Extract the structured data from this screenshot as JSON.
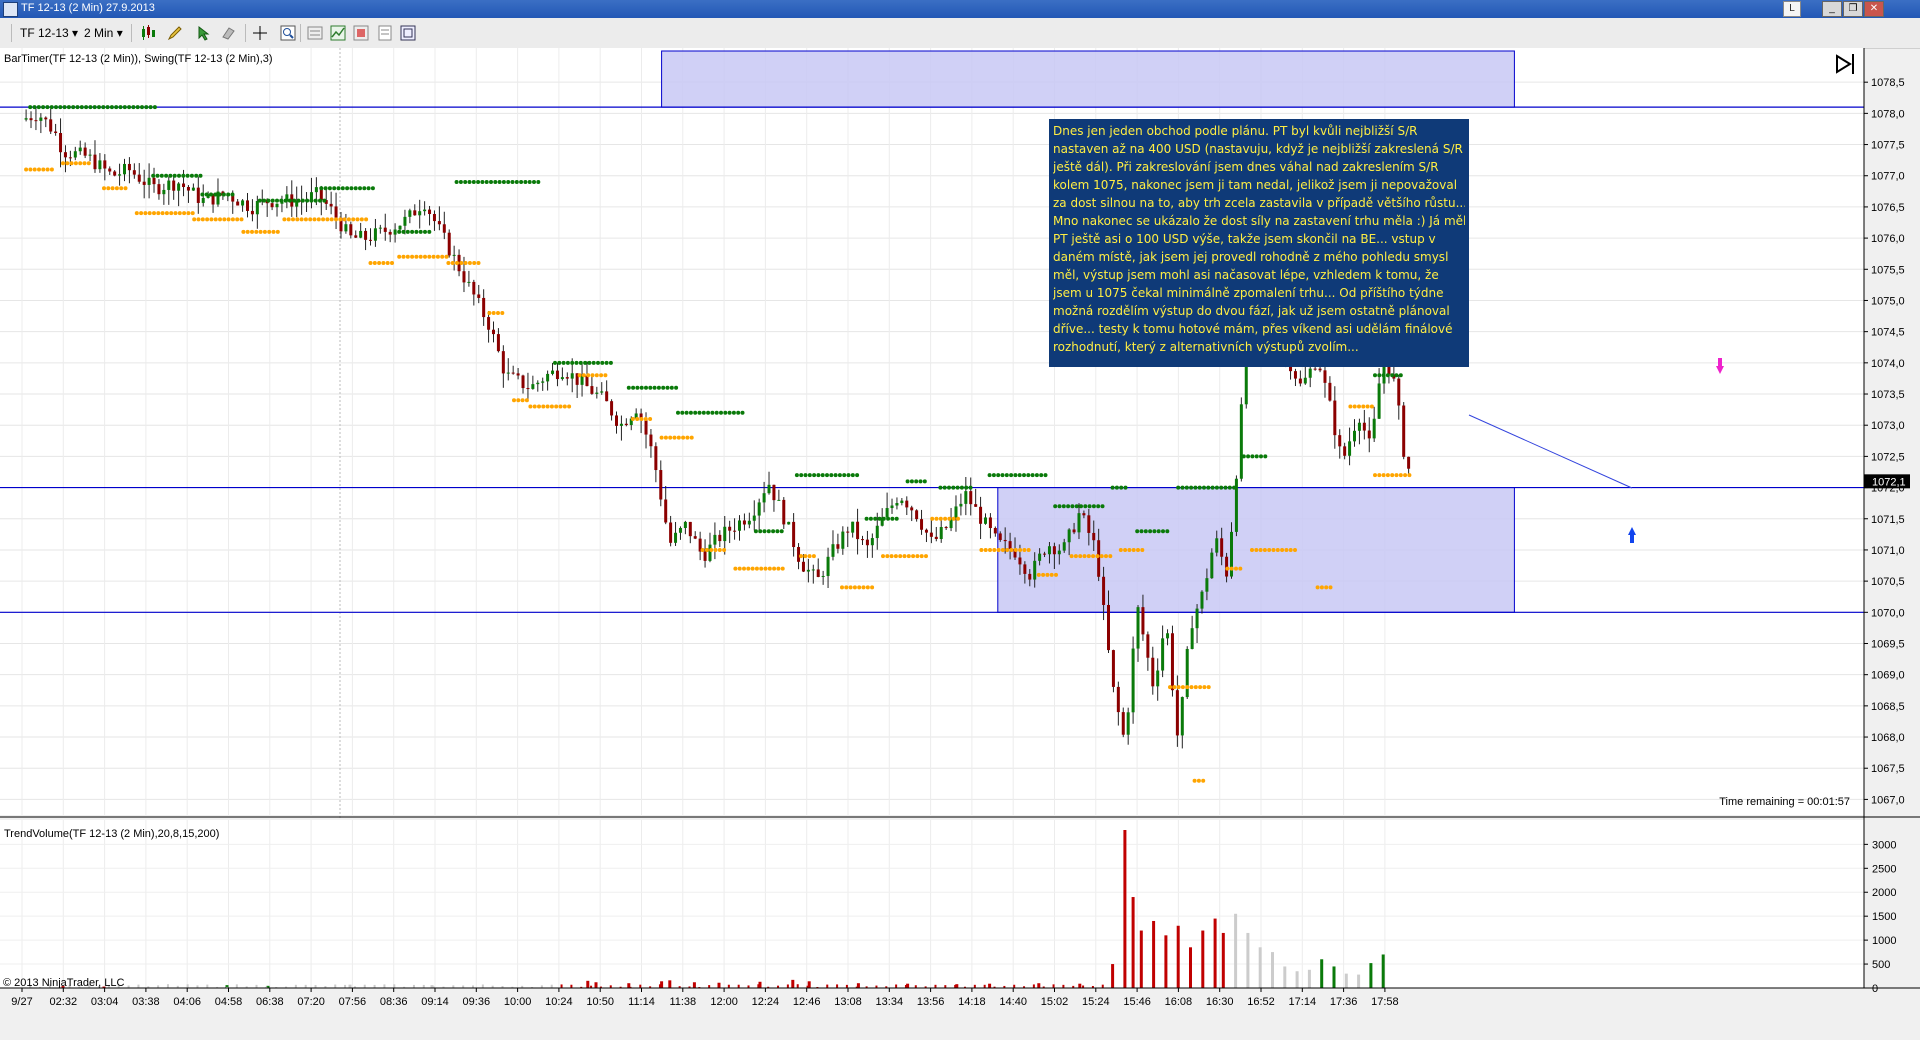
{
  "window": {
    "title": "TF 12-13 (2 Min)   27.9.2013",
    "badge": "L",
    "minimize_glyph": "_",
    "restore_glyph": "❐",
    "close_glyph": "✕"
  },
  "toolbar": {
    "instrument": "TF 12-13",
    "interval": "2 Min",
    "dropdown_glyph": "▾"
  },
  "indicators": {
    "main_label": "BarTimer(TF 12-13 (2 Min)), Swing(TF 12-13 (2 Min),3)",
    "volume_label": "TrendVolume(TF 12-13 (2 Min),20,8,15,200)",
    "time_remaining": "Time remaining = 00:01:57",
    "copyright": "© 2013 NinjaTrader, LLC"
  },
  "annotation": {
    "lines": [
      "Dnes jen jeden obchod podle plánu. PT byl kvůli nejbližší S/R",
      "nastaven až na 400 USD (nastavuju, když je nejbližší zakreslená S/R",
      "ještě dál). Při zakreslování jsem dnes váhal nad zakreslením S/R",
      "kolem 1075, nakonec jsem ji tam nedal, jelikož jsem ji nepovažoval",
      "za dost silnou na to, aby trh zcela zastavila v případě většího růstu...",
      "Mno nakonec se ukázalo že dost síly na zastavení trhu měla :) Já měl",
      "PT ještě asi o 100 USD výše, takže jsem skončil na BE... vstup v",
      "daném místě, jak jsem jej provedl rohodně z mého pohledu smysl",
      "měl, výstup  jsem mohl asi načasovat lépe, vzhledem k tomu, že",
      "jsem u 1075 čekal minimálně zpomalení trhu... Od příštího týdne",
      "možná rozdělím výstup do dvou fází, jak už jsem ostatně plánoval",
      "dříve... testy k tomu hotové mám, přes víkend asi udělám finálové",
      "rozhodnutí, který z alternativních výstupů zvolím..."
    ]
  },
  "chart_data": [
    {
      "type": "candlestick",
      "title": "TF 12-13 (2 Min)",
      "price_axis_ticks": [
        "1078,5",
        "1078,0",
        "1077,5",
        "1077,0",
        "1076,5",
        "1076,0",
        "1075,5",
        "1075,0",
        "1074,5",
        "1074,0",
        "1073,5",
        "1073,0",
        "1072,5",
        "1072,0",
        "1071,5",
        "1071,0",
        "1070,5",
        "1070,0",
        "1069,5",
        "1069,0",
        "1068,5",
        "1068,0",
        "1067,5",
        "1067,0"
      ],
      "ylim": [
        1066.75,
        1079.0
      ],
      "time_axis_ticks": [
        "9/27",
        "02:32",
        "03:04",
        "03:38",
        "04:06",
        "04:58",
        "06:38",
        "07:20",
        "07:56",
        "08:36",
        "09:14",
        "09:36",
        "10:00",
        "10:24",
        "10:50",
        "11:14",
        "11:38",
        "12:00",
        "12:24",
        "12:46",
        "13:08",
        "13:34",
        "13:56",
        "14:18",
        "14:40",
        "15:02",
        "15:24",
        "15:46",
        "16:08",
        "16:30",
        "16:52",
        "17:14",
        "17:36",
        "17:58"
      ],
      "last_price": 1072.1,
      "last_price_label": "1072,1",
      "close_path": [
        [
          0,
          1077.9
        ],
        [
          0.4,
          1078.0
        ],
        [
          0.8,
          1077.7
        ],
        [
          1.0,
          1077.4
        ],
        [
          1.6,
          1077.3
        ],
        [
          2.2,
          1077.0
        ],
        [
          2.6,
          1077.1
        ],
        [
          3.2,
          1076.8
        ],
        [
          3.8,
          1076.9
        ],
        [
          4.4,
          1076.6
        ],
        [
          5.0,
          1076.7
        ],
        [
          5.6,
          1076.5
        ],
        [
          6.0,
          1076.6
        ],
        [
          6.8,
          1076.6
        ],
        [
          7.2,
          1076.7
        ],
        [
          7.6,
          1076.4
        ],
        [
          8.0,
          1076.0
        ],
        [
          8.4,
          1076.0
        ],
        [
          8.8,
          1076.1
        ],
        [
          9.4,
          1076.3
        ],
        [
          9.8,
          1076.6
        ],
        [
          10.2,
          1076.1
        ],
        [
          10.6,
          1075.6
        ],
        [
          11.0,
          1075.1
        ],
        [
          11.4,
          1074.6
        ],
        [
          11.8,
          1073.8
        ],
        [
          12.4,
          1073.6
        ],
        [
          12.8,
          1073.8
        ],
        [
          13.2,
          1073.9
        ],
        [
          13.6,
          1073.7
        ],
        [
          14.2,
          1073.4
        ],
        [
          14.6,
          1073.0
        ],
        [
          15.0,
          1073.3
        ],
        [
          15.4,
          1072.5
        ],
        [
          15.8,
          1071.1
        ],
        [
          16.2,
          1071.4
        ],
        [
          16.6,
          1070.9
        ],
        [
          17.0,
          1071.2
        ],
        [
          17.4,
          1071.4
        ],
        [
          17.8,
          1071.6
        ],
        [
          18.2,
          1072.1
        ],
        [
          18.6,
          1071.5
        ],
        [
          19.0,
          1070.8
        ],
        [
          19.4,
          1070.5
        ],
        [
          19.8,
          1071.0
        ],
        [
          20.2,
          1071.4
        ],
        [
          20.6,
          1071.0
        ],
        [
          21.0,
          1071.5
        ],
        [
          21.4,
          1071.9
        ],
        [
          21.8,
          1071.6
        ],
        [
          22.2,
          1071.1
        ],
        [
          22.6,
          1071.4
        ],
        [
          23.0,
          1071.9
        ],
        [
          23.4,
          1071.5
        ],
        [
          23.8,
          1071.1
        ],
        [
          24.2,
          1071.0
        ],
        [
          24.6,
          1070.6
        ],
        [
          25.0,
          1071.1
        ],
        [
          25.4,
          1071.0
        ],
        [
          25.8,
          1071.6
        ],
        [
          26.2,
          1071.0
        ],
        [
          26.6,
          1068.8
        ],
        [
          26.9,
          1067.9
        ],
        [
          27.2,
          1070.1
        ],
        [
          27.6,
          1068.8
        ],
        [
          27.9,
          1069.9
        ],
        [
          28.2,
          1067.9
        ],
        [
          28.5,
          1069.8
        ],
        [
          28.8,
          1070.3
        ],
        [
          29.1,
          1071.2
        ],
        [
          29.4,
          1070.6
        ],
        [
          29.6,
          1072.1
        ],
        [
          29.8,
          1073.7
        ],
        [
          30.0,
          1075.6
        ],
        [
          30.4,
          1074.6
        ],
        [
          30.8,
          1074.2
        ],
        [
          31.2,
          1073.6
        ],
        [
          31.6,
          1074.1
        ],
        [
          31.9,
          1073.3
        ],
        [
          32.2,
          1072.4
        ],
        [
          32.6,
          1073.2
        ],
        [
          32.9,
          1072.6
        ],
        [
          33.2,
          1074.2
        ],
        [
          33.5,
          1073.6
        ],
        [
          33.7,
          1072.6
        ],
        [
          33.9,
          1072.1
        ]
      ],
      "swing_high_levels": [
        {
          "x0": 0.2,
          "x1": 3.3,
          "y": 1078.1
        },
        {
          "x0": 3.2,
          "x1": 4.4,
          "y": 1077.0
        },
        {
          "x0": 4.4,
          "x1": 5.2,
          "y": 1076.7
        },
        {
          "x0": 5.8,
          "x1": 7.4,
          "y": 1076.6
        },
        {
          "x0": 7.3,
          "x1": 8.6,
          "y": 1076.8
        },
        {
          "x0": 9.2,
          "x1": 10.0,
          "y": 1076.1
        },
        {
          "x0": 10.6,
          "x1": 12.6,
          "y": 1076.9
        },
        {
          "x0": 13.0,
          "x1": 14.4,
          "y": 1074.0
        },
        {
          "x0": 14.8,
          "x1": 16.0,
          "y": 1073.6
        },
        {
          "x0": 16.0,
          "x1": 17.6,
          "y": 1073.2
        },
        {
          "x0": 17.9,
          "x1": 18.6,
          "y": 1071.3
        },
        {
          "x0": 18.9,
          "x1": 20.4,
          "y": 1072.2
        },
        {
          "x0": 20.6,
          "x1": 21.4,
          "y": 1071.5
        },
        {
          "x0": 21.6,
          "x1": 22.1,
          "y": 1072.1
        },
        {
          "x0": 22.4,
          "x1": 23.2,
          "y": 1072.0
        },
        {
          "x0": 23.6,
          "x1": 25.0,
          "y": 1072.2
        },
        {
          "x0": 25.2,
          "x1": 26.4,
          "y": 1071.7
        },
        {
          "x0": 26.6,
          "x1": 27.0,
          "y": 1072.0
        },
        {
          "x0": 27.2,
          "x1": 28.0,
          "y": 1071.3
        },
        {
          "x0": 28.2,
          "x1": 29.6,
          "y": 1072.0
        },
        {
          "x0": 29.8,
          "x1": 30.4,
          "y": 1072.5
        },
        {
          "x0": 30.8,
          "x1": 32.0,
          "y": 1075.8
        },
        {
          "x0": 32.4,
          "x1": 32.9,
          "y": 1074.7
        },
        {
          "x0": 33.0,
          "x1": 33.7,
          "y": 1073.8
        },
        {
          "x0": 33.9,
          "x1": 34.2,
          "y": 1075.2
        }
      ],
      "swing_low_levels": [
        {
          "x0": 0.1,
          "x1": 0.8,
          "y": 1077.1
        },
        {
          "x0": 1.0,
          "x1": 1.7,
          "y": 1077.2
        },
        {
          "x0": 2.0,
          "x1": 2.6,
          "y": 1076.8
        },
        {
          "x0": 2.8,
          "x1": 4.2,
          "y": 1076.4
        },
        {
          "x0": 4.2,
          "x1": 5.4,
          "y": 1076.3
        },
        {
          "x0": 5.4,
          "x1": 6.3,
          "y": 1076.1
        },
        {
          "x0": 6.4,
          "x1": 8.4,
          "y": 1076.3
        },
        {
          "x0": 8.5,
          "x1": 9.1,
          "y": 1075.6
        },
        {
          "x0": 9.2,
          "x1": 10.4,
          "y": 1075.7
        },
        {
          "x0": 10.4,
          "x1": 11.2,
          "y": 1075.6
        },
        {
          "x0": 11.4,
          "x1": 11.8,
          "y": 1074.8
        },
        {
          "x0": 12.0,
          "x1": 12.4,
          "y": 1073.4
        },
        {
          "x0": 12.4,
          "x1": 13.4,
          "y": 1073.3
        },
        {
          "x0": 13.6,
          "x1": 14.3,
          "y": 1073.8
        },
        {
          "x0": 14.9,
          "x1": 15.4,
          "y": 1073.1
        },
        {
          "x0": 15.6,
          "x1": 16.4,
          "y": 1072.8
        },
        {
          "x0": 16.6,
          "x1": 17.2,
          "y": 1071.0
        },
        {
          "x0": 17.4,
          "x1": 18.6,
          "y": 1070.7
        },
        {
          "x0": 19.0,
          "x1": 19.4,
          "y": 1070.9
        },
        {
          "x0": 20.0,
          "x1": 20.8,
          "y": 1070.4
        },
        {
          "x0": 21.0,
          "x1": 22.1,
          "y": 1070.9
        },
        {
          "x0": 22.2,
          "x1": 22.9,
          "y": 1071.5
        },
        {
          "x0": 23.4,
          "x1": 24.6,
          "y": 1071.0
        },
        {
          "x0": 24.8,
          "x1": 25.3,
          "y": 1070.6
        },
        {
          "x0": 25.6,
          "x1": 26.6,
          "y": 1070.9
        },
        {
          "x0": 26.8,
          "x1": 27.4,
          "y": 1071.0
        },
        {
          "x0": 28.0,
          "x1": 29.0,
          "y": 1068.8
        },
        {
          "x0": 29.4,
          "x1": 29.8,
          "y": 1070.7
        },
        {
          "x0": 30.0,
          "x1": 31.1,
          "y": 1071.0
        },
        {
          "x0": 31.6,
          "x1": 32.0,
          "y": 1070.4
        },
        {
          "x0": 32.4,
          "x1": 33.0,
          "y": 1073.3
        },
        {
          "x0": 33.0,
          "x1": 33.9,
          "y": 1072.2
        },
        {
          "x0": 28.6,
          "x1": 28.9,
          "y": 1067.3
        }
      ],
      "horizontal_lines": [
        1078.1,
        1072.0,
        1070.0
      ],
      "zones": [
        {
          "x0": 15.6,
          "x1": 36.4,
          "y0": 1078.1,
          "y1": 1079.0
        },
        {
          "x0": 23.8,
          "x1": 36.4,
          "y0": 1070.0,
          "y1": 1072.0
        }
      ],
      "colors": {
        "up": "#0a7a0a",
        "down": "#8b0000",
        "swing_high": "#0a7a0a",
        "swing_low": "#ffa500",
        "zone": "#c8c8f5",
        "line": "#0000cc"
      }
    },
    {
      "type": "bar",
      "title": "TrendVolume(TF 12-13 (2 Min),20,8,15,200)",
      "axis_ticks": [
        "3000",
        "2500",
        "2000",
        "1500",
        "1000",
        "500",
        "0"
      ],
      "ylim": [
        0,
        3300
      ],
      "bars": [
        {
          "x": 1.0,
          "v": 40,
          "c": "#c00000"
        },
        {
          "x": 2.0,
          "v": 30,
          "c": "#c00000"
        },
        {
          "x": 5.0,
          "v": 60,
          "c": "#0a7a0a"
        },
        {
          "x": 6.0,
          "v": 45,
          "c": "#0a7a0a"
        },
        {
          "x": 8.0,
          "v": 70,
          "c": "#cccccc"
        },
        {
          "x": 10.0,
          "v": 60,
          "c": "#cccccc"
        },
        {
          "x": 13.8,
          "v": 150,
          "c": "#c00000"
        },
        {
          "x": 14.0,
          "v": 120,
          "c": "#c00000"
        },
        {
          "x": 14.8,
          "v": 100,
          "c": "#c00000"
        },
        {
          "x": 15.6,
          "v": 140,
          "c": "#c00000"
        },
        {
          "x": 15.8,
          "v": 160,
          "c": "#c00000"
        },
        {
          "x": 16.4,
          "v": 120,
          "c": "#c00000"
        },
        {
          "x": 17.0,
          "v": 110,
          "c": "#c00000"
        },
        {
          "x": 18.0,
          "v": 130,
          "c": "#c00000"
        },
        {
          "x": 18.8,
          "v": 170,
          "c": "#c00000"
        },
        {
          "x": 19.2,
          "v": 140,
          "c": "#c00000"
        },
        {
          "x": 20.4,
          "v": 100,
          "c": "#c00000"
        },
        {
          "x": 21.6,
          "v": 90,
          "c": "#c00000"
        },
        {
          "x": 22.8,
          "v": 80,
          "c": "#c00000"
        },
        {
          "x": 23.6,
          "v": 90,
          "c": "#c00000"
        },
        {
          "x": 24.8,
          "v": 100,
          "c": "#c00000"
        },
        {
          "x": 25.8,
          "v": 90,
          "c": "#c00000"
        },
        {
          "x": 26.6,
          "v": 500,
          "c": "#c00000"
        },
        {
          "x": 26.9,
          "v": 3300,
          "c": "#c00000"
        },
        {
          "x": 27.1,
          "v": 1900,
          "c": "#c00000"
        },
        {
          "x": 27.3,
          "v": 1200,
          "c": "#c00000"
        },
        {
          "x": 27.6,
          "v": 1400,
          "c": "#c00000"
        },
        {
          "x": 27.9,
          "v": 1100,
          "c": "#c00000"
        },
        {
          "x": 28.2,
          "v": 1300,
          "c": "#c00000"
        },
        {
          "x": 28.5,
          "v": 850,
          "c": "#c00000"
        },
        {
          "x": 28.8,
          "v": 1200,
          "c": "#c00000"
        },
        {
          "x": 29.1,
          "v": 1450,
          "c": "#c00000"
        },
        {
          "x": 29.3,
          "v": 1150,
          "c": "#c00000"
        },
        {
          "x": 29.6,
          "v": 1550,
          "c": "#cccccc"
        },
        {
          "x": 29.9,
          "v": 1150,
          "c": "#cccccc"
        },
        {
          "x": 30.2,
          "v": 850,
          "c": "#cccccc"
        },
        {
          "x": 30.5,
          "v": 750,
          "c": "#cccccc"
        },
        {
          "x": 30.8,
          "v": 450,
          "c": "#cccccc"
        },
        {
          "x": 31.1,
          "v": 350,
          "c": "#cccccc"
        },
        {
          "x": 31.4,
          "v": 380,
          "c": "#cccccc"
        },
        {
          "x": 31.7,
          "v": 600,
          "c": "#0a7a0a"
        },
        {
          "x": 32.0,
          "v": 450,
          "c": "#0a7a0a"
        },
        {
          "x": 32.3,
          "v": 300,
          "c": "#cccccc"
        },
        {
          "x": 32.6,
          "v": 280,
          "c": "#cccccc"
        },
        {
          "x": 32.9,
          "v": 520,
          "c": "#0a7a0a"
        },
        {
          "x": 33.2,
          "v": 700,
          "c": "#0a7a0a"
        }
      ],
      "colors": {
        "up": "#0a7a0a",
        "down": "#c00000",
        "neutral": "#cccccc"
      }
    }
  ]
}
